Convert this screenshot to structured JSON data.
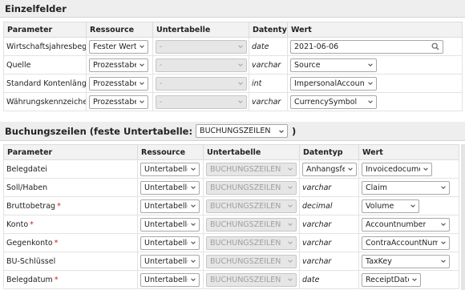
{
  "single": {
    "title": "Einzelfelder",
    "headers": [
      "Parameter",
      "Ressource",
      "Untertabelle",
      "Datentyp",
      "Wert"
    ],
    "rows": [
      {
        "param": "Wirtschaftsjahresbeginn",
        "required": true,
        "resource": "Fester Wert",
        "subtable": "-",
        "datatype": "date",
        "value": "2021-06-06",
        "value_kind": "input"
      },
      {
        "param": "Quelle",
        "required": false,
        "resource": "Prozesstabelle",
        "subtable": "-",
        "datatype": "varchar",
        "value": "Source",
        "value_kind": "select"
      },
      {
        "param": "Standard Kontenlänge",
        "required": false,
        "resource": "Prozesstabelle",
        "subtable": "-",
        "datatype": "int",
        "value": "ImpersonalAccountsLe",
        "value_kind": "select"
      },
      {
        "param": "Währungskennzeichen",
        "required": false,
        "resource": "Prozesstabelle",
        "subtable": "-",
        "datatype": "varchar",
        "value": "CurrencySymbol",
        "value_kind": "select"
      }
    ]
  },
  "booking": {
    "title": "Buchungszeilen (feste Untertabelle:",
    "subtable_select": "BUCHUNGSZEILEN",
    "title_close": ")",
    "headers": [
      "Parameter",
      "Ressource",
      "Untertabelle",
      "Datentyp",
      "Wert"
    ],
    "rows": [
      {
        "param": "Belegdatei",
        "required": false,
        "resource": "Untertabelle",
        "subtable": "BUCHUNGSZEILEN",
        "datatype": "Anhangsfeld",
        "datatype_kind": "select",
        "value": "Invoicedocument"
      },
      {
        "param": "Soll/Haben",
        "required": false,
        "resource": "Untertabelle",
        "subtable": "BUCHUNGSZEILEN",
        "datatype": "varchar",
        "datatype_kind": "text",
        "value": "Claim"
      },
      {
        "param": "Bruttobetrag",
        "required": true,
        "resource": "Untertabelle",
        "subtable": "BUCHUNGSZEILEN",
        "datatype": "decimal",
        "datatype_kind": "text",
        "value": "Volume"
      },
      {
        "param": "Konto",
        "required": true,
        "resource": "Untertabelle",
        "subtable": "BUCHUNGSZEILEN",
        "datatype": "varchar",
        "datatype_kind": "text",
        "value": "Accountnumber"
      },
      {
        "param": "Gegenkonto",
        "required": true,
        "resource": "Untertabelle",
        "subtable": "BUCHUNGSZEILEN",
        "datatype": "varchar",
        "datatype_kind": "text",
        "value": "ContraAccountNumber"
      },
      {
        "param": "BU-Schlüssel",
        "required": false,
        "resource": "Untertabelle",
        "subtable": "BUCHUNGSZEILEN",
        "datatype": "varchar",
        "datatype_kind": "text",
        "value": "TaxKey"
      },
      {
        "param": "Belegdatum",
        "required": true,
        "resource": "Untertabelle",
        "subtable": "BUCHUNGSZEILEN",
        "datatype": "date",
        "datatype_kind": "text",
        "value": "ReceiptDate"
      }
    ]
  },
  "required_marker": "*",
  "icons": {
    "dropdown": "chevron-down-icon",
    "search": "search-icon"
  },
  "colors": {
    "required": "#cc2222",
    "header_bg": "#f2f2f2",
    "section_bg": "#eeeeee",
    "disabled_bg": "#e6e6e6"
  }
}
